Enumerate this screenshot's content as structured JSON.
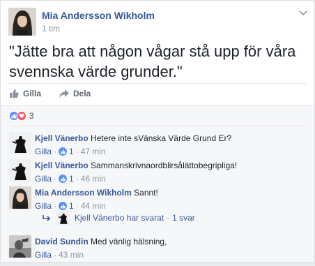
{
  "post": {
    "author": "Mia Andersson Wikholm",
    "time": "1 tim",
    "text": "\"Jätte bra att någon vågar stå upp för våra svennska värde grunder.\""
  },
  "actions": {
    "like_label": "Gilla",
    "share_label": "Dela"
  },
  "reactions": {
    "count": "3",
    "icons": [
      "like-icon",
      "love-icon"
    ]
  },
  "comments": [
    {
      "author": "Kjell Vänerbo",
      "text": "Hetere inte sVänska Värde Grund Er?",
      "like_label": "Gilla",
      "likes": "1",
      "time": "47 min"
    },
    {
      "author": "Kjell Vänerbo",
      "text": "Sammanskrivnaordblirsålättobegripliga!",
      "like_label": "Gilla",
      "likes": "1",
      "time": "46 min"
    },
    {
      "author": "Mia Andersson Wikholm",
      "text": "Sannt!",
      "like_label": "Gilla",
      "likes": "1",
      "time": "44 min"
    },
    {
      "author": "David Sundin",
      "text": "Med vänlig hälsning,",
      "like_label": "Gilla",
      "time": "43 min"
    }
  ],
  "reply_summary": {
    "text": "Kjell Vänerbo har svarat",
    "count": "1 svar"
  },
  "colors": {
    "link": "#365899",
    "muted": "#90949c",
    "like_blue": "#5890ff",
    "love_red": "#f25268",
    "comments_bg": "#f6f7f9"
  }
}
